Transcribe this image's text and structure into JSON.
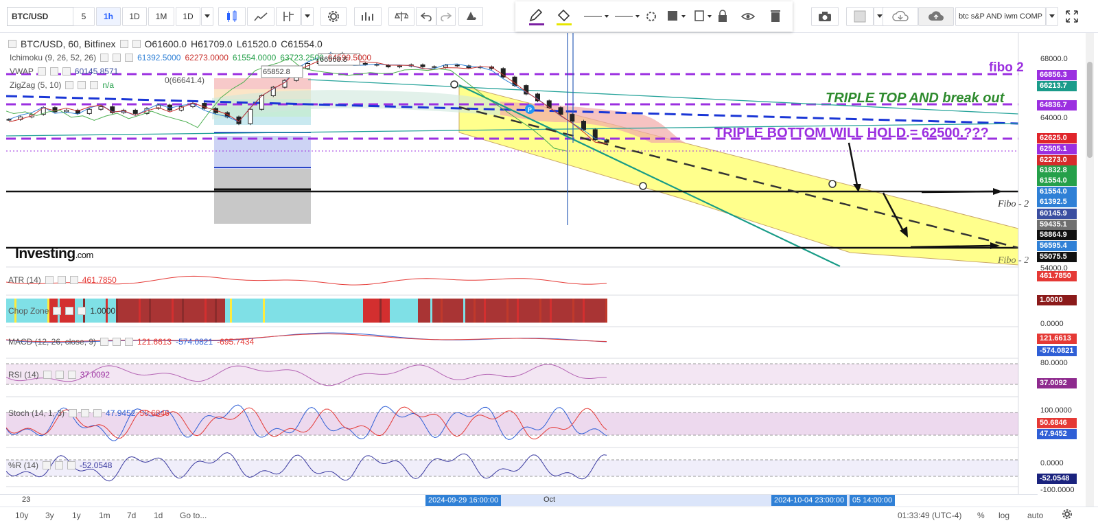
{
  "header": {
    "symbol": "BTC/USD",
    "intervals": [
      "5",
      "1h",
      "1D",
      "1M",
      "1D"
    ],
    "active_interval": "1h",
    "layout_name": "btc s&P AND iwm COMP"
  },
  "legend": {
    "main": {
      "title": "BTC/USD, 60, Bitfinex",
      "o": "O61600.0",
      "h": "H61709.0",
      "l": "L61520.0",
      "c": "C61554.0"
    },
    "ichimoku": {
      "name": "Ichimoku (9, 26, 52, 26)",
      "values": [
        "61392.5000",
        "62273.0000",
        "61554.0000",
        "63723.2500",
        "64599.5000"
      ]
    },
    "vwap": {
      "name": "VWAP",
      "value": "60145.8571"
    },
    "zigzag": {
      "name": "ZigZag (5, 10)",
      "value": "n/a"
    },
    "atr": {
      "name": "ATR (14)",
      "value": "461.7850"
    },
    "chop": {
      "name": "Chop Zone",
      "value": "1.0000"
    },
    "macd": {
      "name": "MACD (12, 26, close, 9)",
      "values": [
        "121.6613",
        "-574.0821",
        "-695.7434"
      ]
    },
    "rsi": {
      "name": "RSI (14)",
      "value": "37.0092"
    },
    "stoch": {
      "name": "Stoch (14, 1, 3)",
      "values": [
        "47.9452",
        "50.6846"
      ]
    },
    "wr": {
      "name": "%R (14)",
      "value": "-52.0548"
    }
  },
  "annotations": {
    "fibo2_top": "fibo 2",
    "triple_top": "TRIPLE TOP AND break out",
    "triple_bottom": "TRIPLE BOTTOM WILL HOLD.= 62500.???",
    "fibo2_mid": "Fibo - 2",
    "fibo2_low": "Fibo - 2",
    "box1": "65852.8",
    "box2": "66568.8",
    "zig_label": "0(66641.4)",
    "watermark": "Investing",
    "watermark_suffix": ".com"
  },
  "price_axis": {
    "ticks": [
      "68000.0",
      "64000.0",
      "54000.0"
    ],
    "labels": [
      {
        "v": "66856.3",
        "c": "#9b2fe0"
      },
      {
        "v": "66213.7",
        "c": "#1a9b8a"
      },
      {
        "v": "64836.7",
        "c": "#9b2fe0"
      },
      {
        "v": "62625.0",
        "c": "#e0242a"
      },
      {
        "v": "62505.1",
        "c": "#9b2fe0"
      },
      {
        "v": "62273.0",
        "c": "#d62b2b"
      },
      {
        "v": "61832.8",
        "c": "#25a04a"
      },
      {
        "v": "61554.0",
        "c": "#25a04a"
      },
      {
        "v": "61554.0",
        "c": "#2f80d6"
      },
      {
        "v": "61392.5",
        "c": "#2f80d6"
      },
      {
        "v": "60145.9",
        "c": "#3a4ea0"
      },
      {
        "v": "59435.1",
        "c": "#6f6f6f"
      },
      {
        "v": "58864.9",
        "c": "#111111"
      },
      {
        "v": "56595.4",
        "c": "#2f80d6"
      },
      {
        "v": "55075.5",
        "c": "#111111"
      }
    ],
    "atr_label": "461.7850",
    "chop_label": "1.0000",
    "chop_tick": "0.0000",
    "macd_labels": [
      "121.6613",
      "-574.0821"
    ],
    "rsi_tick": "80.0000",
    "rsi_label": "37.0092",
    "stoch_tick": "100.0000",
    "stoch_labels": [
      "50.6846",
      "47.9452"
    ],
    "wr_ticks": [
      "0.0000",
      "-100.0000"
    ],
    "wr_label": "-52.0548"
  },
  "time_axis": {
    "label_23": "23",
    "label_oct": "Oct",
    "badge1": "2024-09-29 16:00:00",
    "badge2": "2024-10-04 23:00:00",
    "badge3": "05 14:00:00"
  },
  "bottom_bar": {
    "ranges": [
      "10y",
      "3y",
      "1y",
      "1m",
      "7d",
      "1d"
    ],
    "goto": "Go to...",
    "clock": "01:33:49 (UTC-4)",
    "pct": "%",
    "log": "log",
    "auto": "auto"
  },
  "chart_data": {
    "type": "line",
    "title": "BTC/USD, 60, Bitfinex",
    "ylim": [
      54000,
      68000
    ],
    "series": [
      {
        "name": "BTC/USD",
        "values": [
          62900,
          63050,
          63200,
          63600,
          63350,
          63450,
          63250,
          63500,
          63650,
          63300,
          63450,
          63250,
          63550,
          63750,
          63450,
          63650,
          63850,
          63550,
          63300,
          63050,
          62650,
          63500,
          64300,
          64800,
          65200,
          65900,
          66200,
          66450,
          66800,
          66300,
          66200,
          66150,
          66100,
          66000,
          66050,
          66120,
          66010,
          65980,
          66100,
          66060,
          65950,
          66000,
          65900,
          65400,
          64900,
          64400,
          64000,
          63600,
          63200,
          62800,
          62300,
          61700,
          61554
        ]
      }
    ]
  }
}
